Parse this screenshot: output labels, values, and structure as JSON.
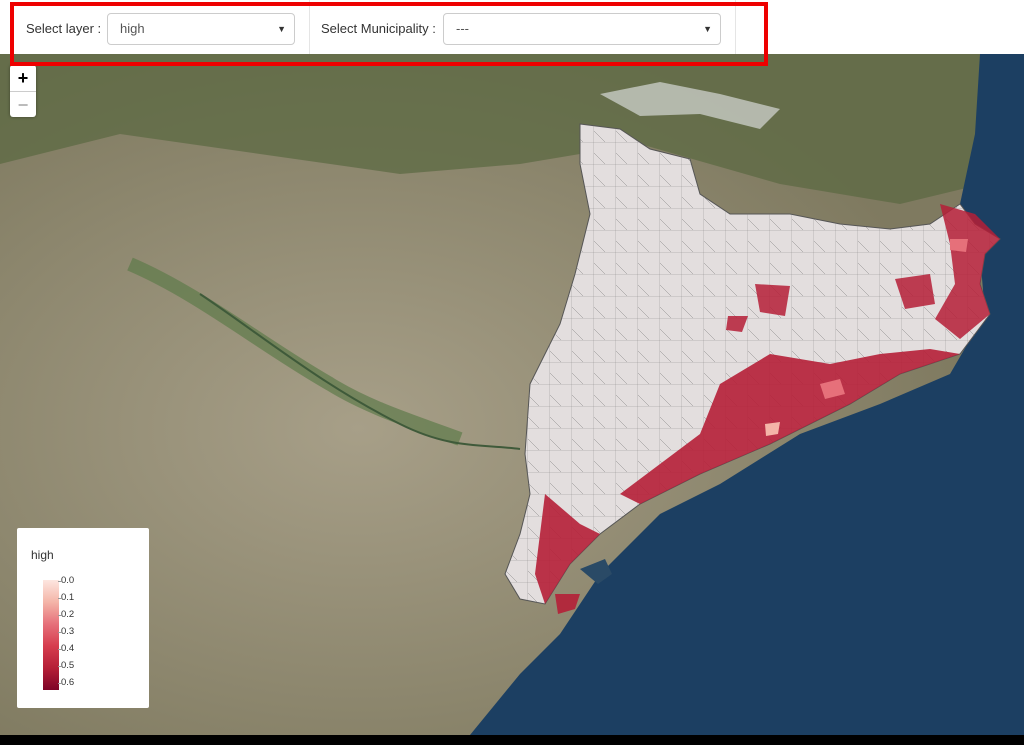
{
  "toolbar": {
    "layer_label": "Select layer :",
    "layer_value": "high",
    "municipality_label": "Select Municipality :",
    "municipality_value": "---"
  },
  "zoom": {
    "in": "+",
    "out": "−"
  },
  "legend": {
    "title": "high",
    "ticks": [
      "0.0",
      "0.1",
      "0.2",
      "0.3",
      "0.4",
      "0.5",
      "0.6"
    ]
  },
  "colors": {
    "highlight": "#e00000",
    "sea": "#1c3f62",
    "land": "#8d8870",
    "region_fill": "#e3dede",
    "high_risk": "#b51f37",
    "scale_low": "#fde6e0",
    "scale_high": "#7e0427"
  }
}
